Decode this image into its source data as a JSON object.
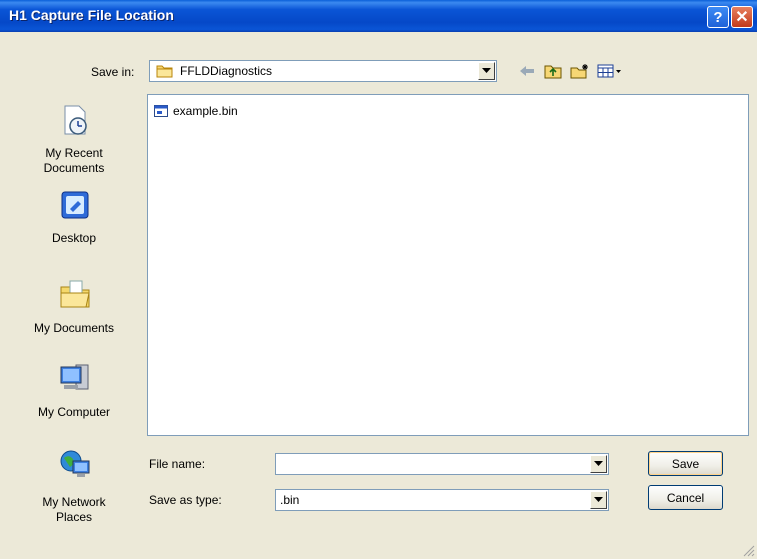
{
  "window": {
    "title": "H1 Capture File Location",
    "help_label": "?",
    "close_label": "✕"
  },
  "toolbar": {
    "save_in_label": "Save in:",
    "save_in_value": "FFLDDiagnostics",
    "icons": [
      "back-arrow-icon",
      "up-folder-icon",
      "new-folder-icon",
      "view-menu-icon"
    ]
  },
  "places": [
    {
      "label": "My Recent\nDocuments",
      "icon": "recent-documents-icon"
    },
    {
      "label": "Desktop",
      "icon": "desktop-icon"
    },
    {
      "label": "My Documents",
      "icon": "my-documents-icon"
    },
    {
      "label": "My Computer",
      "icon": "my-computer-icon"
    },
    {
      "label": "My Network\nPlaces",
      "icon": "network-places-icon"
    }
  ],
  "files": [
    {
      "name": "example.bin",
      "icon": "bin-file-icon"
    }
  ],
  "form": {
    "file_name_label": "File name:",
    "file_name_value": "",
    "save_as_type_label": "Save as type:",
    "save_as_type_value": ".bin"
  },
  "buttons": {
    "save": "Save",
    "cancel": "Cancel"
  },
  "colors": {
    "titlebar": "#0548c8",
    "dialog_bg": "#ece9d8",
    "border": "#7f9db9"
  }
}
